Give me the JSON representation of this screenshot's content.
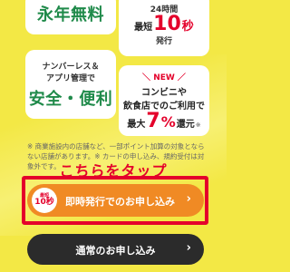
{
  "features": {
    "free": {
      "text": "永年無料"
    },
    "fast": {
      "line1": "24時間",
      "prefix": "最短",
      "number": "10",
      "unit": "秒",
      "suffix": "発行"
    },
    "safe": {
      "line1": "ナンバーレス＆",
      "line2": "アプリ管理で",
      "main": "安全・便利"
    },
    "pay": {
      "tag": "NEW",
      "line1": "コンビニや",
      "line2": "飲食店でのご利用で",
      "prefix": "最大",
      "number": "7",
      "pct": "%",
      "suffix": "還元",
      "note": "※"
    }
  },
  "notice": "※ 商業施設内の店舗など、一部ポイント加算の対象とならない店舗があります。※ カードの申し込み、規約受付は対象外です。",
  "tap_label": "こちらをタップ",
  "buttons": {
    "instant": {
      "badge_top": "最短",
      "badge_main": "10秒",
      "label": "即時発行でのお申し込み",
      "chevron": "›"
    },
    "normal": {
      "label": "通常のお申し込み",
      "chevron": "›"
    }
  },
  "colors": {
    "background": "#f3e845",
    "accent_red": "#e4002b",
    "green": "#1f8a4a",
    "orange_button": "#f08a24",
    "dark_button": "#2b2b2b"
  }
}
